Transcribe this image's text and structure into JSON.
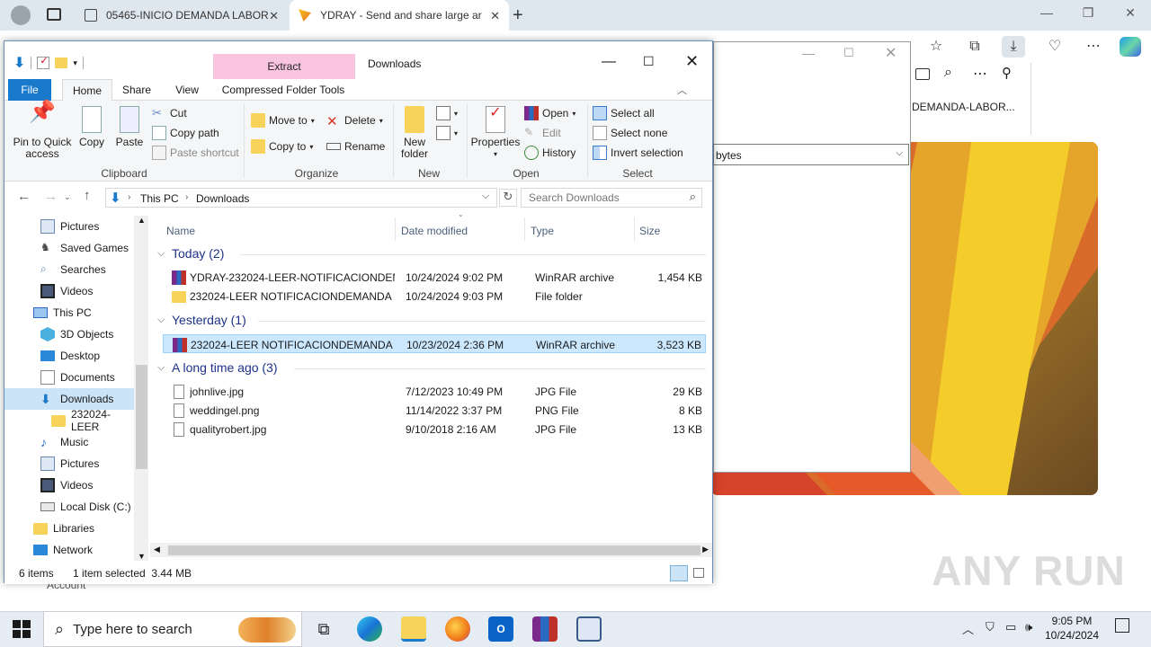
{
  "browser": {
    "tabs": [
      {
        "label": "05465-INICIO DEMANDA LABOR"
      },
      {
        "label": "YDRAY - Send and share large ar"
      }
    ],
    "webpage_title_text": "DEMANDA-LABOR...",
    "bytes_select": "bytes",
    "footer_text": "Account",
    "watermark": "ANY RUN"
  },
  "explorer": {
    "window_title": "Downloads",
    "extract_band": "Extract",
    "ribbon_tabs": [
      "File",
      "Home",
      "Share",
      "View",
      "Compressed Folder Tools"
    ],
    "clipboard": {
      "pin": "Pin to Quick access",
      "copy": "Copy",
      "paste": "Paste",
      "cut": "Cut",
      "copy_path": "Copy path",
      "paste_shortcut": "Paste shortcut",
      "label": "Clipboard"
    },
    "organize": {
      "move_to": "Move to",
      "copy_to": "Copy to",
      "delete": "Delete",
      "rename": "Rename",
      "label": "Organize"
    },
    "new": {
      "new_folder": "New folder",
      "label": "New"
    },
    "open": {
      "properties": "Properties",
      "open": "Open",
      "edit": "Edit",
      "history": "History",
      "label": "Open"
    },
    "select": {
      "select_all": "Select all",
      "select_none": "Select none",
      "invert": "Invert selection",
      "label": "Select"
    },
    "address": {
      "this_pc": "This PC",
      "downloads": "Downloads"
    },
    "search_placeholder": "Search Downloads",
    "nav_items": [
      {
        "label": "Pictures"
      },
      {
        "label": "Saved Games"
      },
      {
        "label": "Searches"
      },
      {
        "label": "Videos"
      },
      {
        "label": "This PC"
      },
      {
        "label": "3D Objects"
      },
      {
        "label": "Desktop"
      },
      {
        "label": "Documents"
      },
      {
        "label": "Downloads"
      },
      {
        "label": "232024-LEER"
      },
      {
        "label": "Music"
      },
      {
        "label": "Pictures"
      },
      {
        "label": "Videos"
      },
      {
        "label": "Local Disk (C:)"
      },
      {
        "label": "Libraries"
      },
      {
        "label": "Network"
      }
    ],
    "columns": {
      "name": "Name",
      "date": "Date modified",
      "type": "Type",
      "size": "Size"
    },
    "groups": [
      {
        "label": "Today (2)"
      },
      {
        "label": "Yesterday (1)"
      },
      {
        "label": "A long time ago (3)"
      }
    ],
    "files": [
      {
        "name": "YDRAY-232024-LEER-NOTIFICACIONDEM...",
        "date": "10/24/2024 9:02 PM",
        "type": "WinRAR archive",
        "size": "1,454 KB"
      },
      {
        "name": "232024-LEER NOTIFICACIONDEMANDA L...",
        "date": "10/24/2024 9:03 PM",
        "type": "File folder",
        "size": ""
      },
      {
        "name": "232024-LEER NOTIFICACIONDEMANDA L...",
        "date": "10/23/2024 2:36 PM",
        "type": "WinRAR archive",
        "size": "3,523 KB"
      },
      {
        "name": "johnlive.jpg",
        "date": "7/12/2023 10:49 PM",
        "type": "JPG File",
        "size": "29 KB"
      },
      {
        "name": "weddingel.png",
        "date": "11/14/2022 3:37 PM",
        "type": "PNG File",
        "size": "8 KB"
      },
      {
        "name": "qualityrobert.jpg",
        "date": "9/10/2018 2:16 AM",
        "type": "JPG File",
        "size": "13 KB"
      }
    ],
    "status": {
      "items": "6 items",
      "selected": "1 item selected  3.44 MB"
    }
  },
  "taskbar": {
    "search_placeholder": "Type here to search",
    "time": "9:05 PM",
    "date": "10/24/2024"
  }
}
